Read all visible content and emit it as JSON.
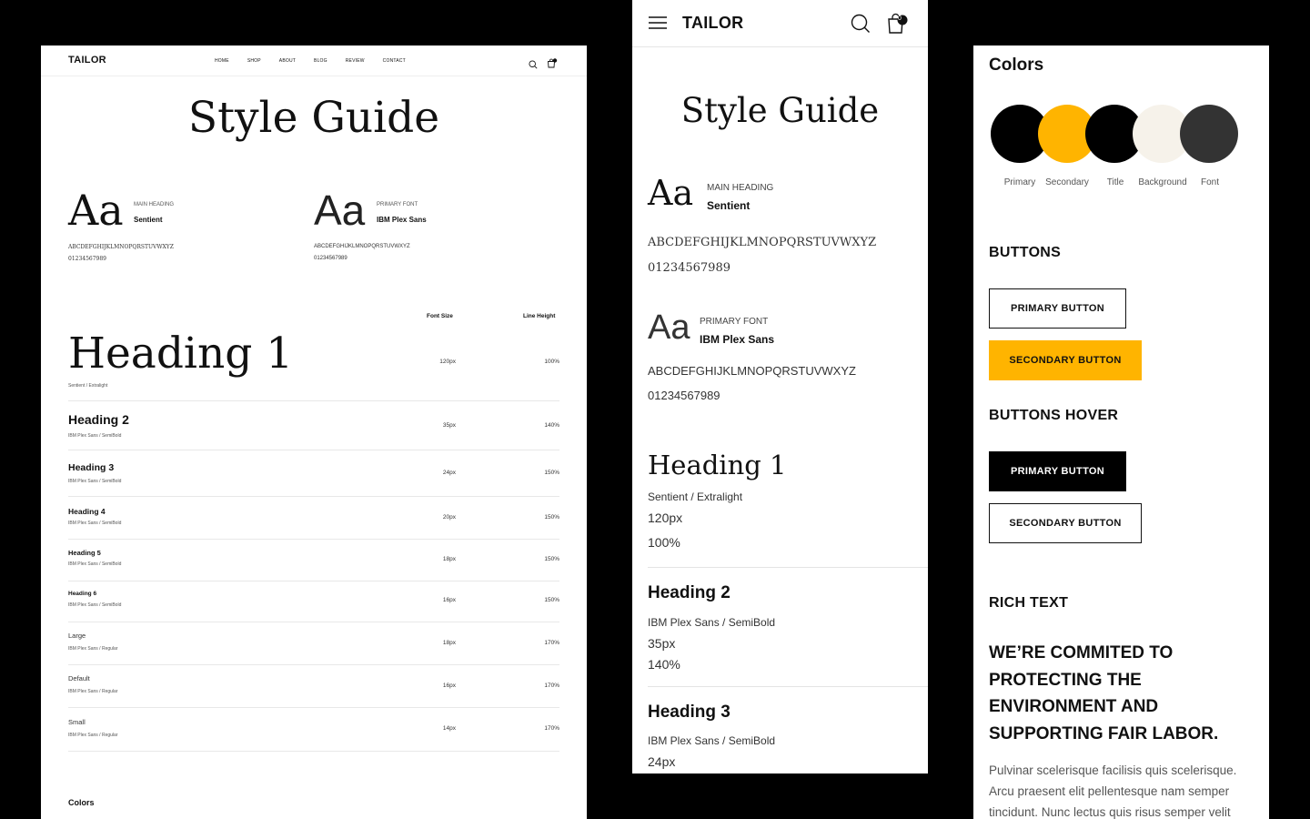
{
  "desktop": {
    "logo": "TAILOR",
    "nav": [
      "HOME",
      "SHOP",
      "ABOUT",
      "BLOG",
      "REVIEW",
      "CONTACT"
    ],
    "title": "Style Guide",
    "main_font": {
      "sample": "Aa",
      "caption": "MAIN HEADING",
      "name": "Sentient",
      "alphabet": "ABCDEFGHIJKLMNOPQRSTUVWXYZ",
      "digits": "01234567989"
    },
    "primary_font": {
      "sample": "Aa",
      "caption": "PRIMARY FONT",
      "name": "IBM Plex Sans",
      "alphabet": "ABCDEFGHIJKLMNOPQRSTUVWXYZ",
      "digits": "01234567989"
    },
    "col_font_size": "Font Size",
    "col_line_height": "Line Height",
    "rows": [
      {
        "label": "Heading 1",
        "sub": "Sentient / Extralight",
        "size": "120px",
        "lh": "100%"
      },
      {
        "label": "Heading 2",
        "sub": "IBM Plex Sans / SemiBold",
        "size": "35px",
        "lh": "140%"
      },
      {
        "label": "Heading 3",
        "sub": "IBM Plex Sans / SemiBold",
        "size": "24px",
        "lh": "150%"
      },
      {
        "label": "Heading 4",
        "sub": "IBM Plex Sans / SemiBold",
        "size": "20px",
        "lh": "150%"
      },
      {
        "label": "Heading 5",
        "sub": "IBM Plex Sans / SemiBold",
        "size": "18px",
        "lh": "150%"
      },
      {
        "label": "Heading 6",
        "sub": "IBM Plex Sans / SemiBold",
        "size": "16px",
        "lh": "150%"
      },
      {
        "label": "Large",
        "sub": "IBM Plex Sans / Regular",
        "size": "18px",
        "lh": "170%"
      },
      {
        "label": "Default",
        "sub": "IBM Plex Sans / Regular",
        "size": "16px",
        "lh": "170%"
      },
      {
        "label": "Small",
        "sub": "IBM Plex Sans / Regular",
        "size": "14px",
        "lh": "170%"
      }
    ],
    "colors_heading": "Colors",
    "cart_count": ""
  },
  "mobile": {
    "logo": "TAILOR",
    "cart_count": "0",
    "title": "Style Guide",
    "main_font": {
      "sample": "Aa",
      "caption": "MAIN HEADING",
      "name": "Sentient",
      "alphabet": "ABCDEFGHIJKLMNOPQRSTUVWXYZ",
      "digits": "01234567989"
    },
    "primary_font": {
      "sample": "Aa",
      "caption": "PRIMARY FONT",
      "name": "IBM Plex Sans",
      "alphabet": "ABCDEFGHIJKLMNOPQRSTUVWXYZ",
      "digits": "01234567989"
    },
    "h1": {
      "label": "Heading 1",
      "sub": "Sentient / Extralight",
      "size": "120px",
      "lh": "100%"
    },
    "h2": {
      "label": "Heading 2",
      "sub": "IBM Plex Sans / SemiBold",
      "size": "35px",
      "lh": "140%"
    },
    "h3": {
      "label": "Heading 3",
      "sub": "IBM Plex Sans / SemiBold",
      "size": "24px"
    }
  },
  "components": {
    "colors_heading": "Colors",
    "swatches": [
      {
        "label": "Primary",
        "color": "#000000"
      },
      {
        "label": "Secondary",
        "color": "#FFB400"
      },
      {
        "label": "Title",
        "color": "#000000"
      },
      {
        "label": "Background",
        "color": "#F6F2EA"
      },
      {
        "label": "Font",
        "color": "#333333"
      }
    ],
    "buttons_heading": "BUTTONS",
    "buttons_hover_heading": "BUTTONS HOVER",
    "primary_button": "PRIMARY BUTTON",
    "secondary_button": "SECONDARY BUTTON",
    "rich_text_heading": "RICH TEXT",
    "rich_title": "WE’RE COMMITED TO PROTECTING THE ENVIRONMENT AND SUPPORTING FAIR LABOR.",
    "rich_body": "Pulvinar scelerisque facilisis quis scelerisque. Arcu praesent elit pellentesque nam semper tincidunt. Nunc lectus quis risus semper velit",
    "accent": "#FFB400"
  }
}
